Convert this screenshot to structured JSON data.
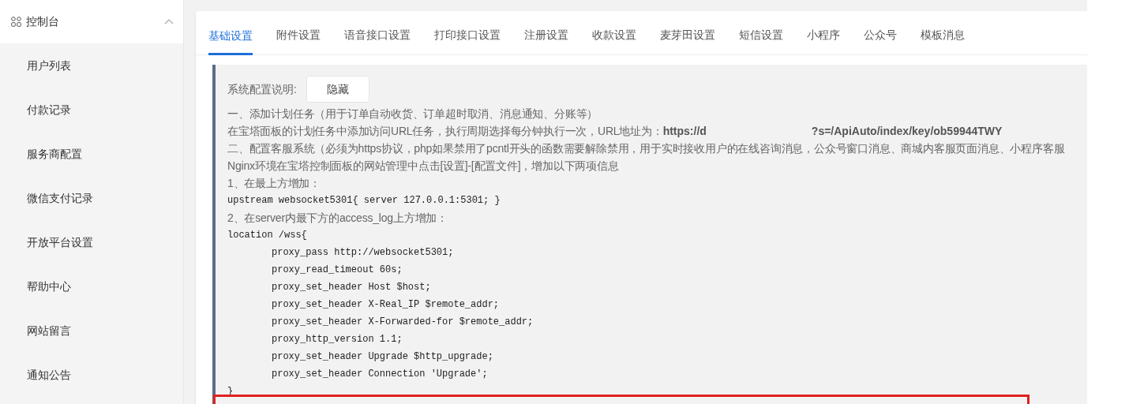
{
  "sidebar": {
    "header": {
      "label": "控制台",
      "expanded": true
    },
    "items": [
      {
        "label": "用户列表"
      },
      {
        "label": "付款记录"
      },
      {
        "label": "服务商配置"
      },
      {
        "label": "微信支付记录"
      },
      {
        "label": "开放平台设置"
      },
      {
        "label": "帮助中心"
      },
      {
        "label": "网站留言"
      },
      {
        "label": "通知公告"
      }
    ]
  },
  "tabs": [
    {
      "label": "基础设置",
      "selected": true
    },
    {
      "label": "附件设置",
      "selected": false
    },
    {
      "label": "语音接口设置",
      "selected": false
    },
    {
      "label": "打印接口设置",
      "selected": false
    },
    {
      "label": "注册设置",
      "selected": false
    },
    {
      "label": "收款设置",
      "selected": false
    },
    {
      "label": "麦芽田设置",
      "selected": false
    },
    {
      "label": "短信设置",
      "selected": false
    },
    {
      "label": "小程序",
      "selected": false
    },
    {
      "label": "公众号",
      "selected": false
    },
    {
      "label": "模板消息",
      "selected": false
    }
  ],
  "notice": {
    "label": "系统配置说明:",
    "toggle_button": "隐藏",
    "lines": [
      {
        "kind": "text",
        "text": "一、添加计划任务（用于订单自动收货、订单超时取消、消息通知、分账等）"
      },
      {
        "kind": "url",
        "text": "在宝塔面板的计划任务中添加访问URL任务，执行周期选择每分钟执行一次，URL地址为：",
        "url_start": "https://d",
        "url_end": "?s=/ApiAuto/index/key/ob59944TWY"
      },
      {
        "kind": "text",
        "text": "二、配置客服系统（必须为https协议，php如果禁用了pcntl开头的函数需要解除禁用，用于实时接收用户的在线咨询消息，公众号窗口消息、商城内客服页面消息、小程序客服"
      },
      {
        "kind": "text",
        "text": "Nginx环境在宝塔控制面板的网站管理中点击[设置]-[配置文件]，增加以下两项信息"
      },
      {
        "kind": "text",
        "text": "1、在最上方增加："
      },
      {
        "kind": "code",
        "text": "upstream websocket5301{ server 127.0.0.1:5301; }"
      },
      {
        "kind": "text",
        "text": "2、在server内最下方的access_log上方增加："
      },
      {
        "kind": "code",
        "text": "location /wss{"
      },
      {
        "kind": "code_indent",
        "text": "proxy_pass http://websocket5301;"
      },
      {
        "kind": "code_indent",
        "text": "proxy_read_timeout 60s;"
      },
      {
        "kind": "code_indent",
        "text": "proxy_set_header Host $host;"
      },
      {
        "kind": "code_indent",
        "text": "proxy_set_header X-Real_IP $remote_addr;"
      },
      {
        "kind": "code_indent",
        "text": "proxy_set_header X-Forwarded-for $remote_addr;"
      },
      {
        "kind": "code_indent",
        "text": "proxy_http_version 1.1;"
      },
      {
        "kind": "code_indent",
        "text": "proxy_set_header Upgrade $http_upgrade;"
      },
      {
        "kind": "code_indent",
        "text": "proxy_set_header Connection 'Upgrade';"
      },
      {
        "kind": "code",
        "text": "}"
      }
    ]
  }
}
